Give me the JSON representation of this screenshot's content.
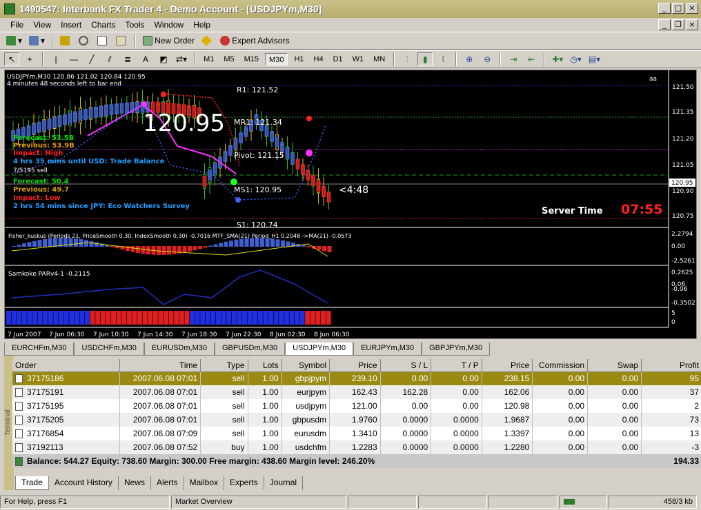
{
  "window": {
    "title": "1490547: Interbank FX Trader 4 - Demo Account - [USDJPYm,M30]"
  },
  "menu": [
    "File",
    "View",
    "Insert",
    "Charts",
    "Tools",
    "Window",
    "Help"
  ],
  "toolbar": {
    "new_order": "New Order",
    "expert_advisors": "Expert Advisors"
  },
  "timeframes": [
    "M1",
    "M5",
    "M15",
    "M30",
    "H1",
    "H4",
    "D1",
    "W1",
    "MN"
  ],
  "active_timeframe": "M30",
  "chart": {
    "header": "USDJPYm,M30  120.86 121.02 120.84 120.95",
    "bar_timer": "4 minutes 48 seconds left to bar end",
    "big_price": "120.95",
    "countdown": "<4:48",
    "server_time_label": "Server Time",
    "server_time": "07:55",
    "aa_label": "aa",
    "levels": {
      "r1": "R1: 121.52",
      "mr1": "MR1: 121.34",
      "pivot": "Pivot: 121.15",
      "ms1": "MS1: 120.95",
      "s1": "S1: 120.74"
    },
    "news": {
      "f1": "Forecast: 53.5B",
      "p1": "Previous: 53.9B",
      "i1": "Impact: High",
      "t1": "4 hrs 35 mins until USD: Trade Balance",
      "sell": "7/5195 sell",
      "f2": "Forecast: 50.4",
      "p2": "Previous: 49.7",
      "i2": "Impact: Low",
      "t2": "2 hrs 54 mins since JPY: Eco Watchers Survey"
    },
    "price_axis": [
      "121.50",
      "121.35",
      "121.20",
      "121.05",
      "120.95",
      "120.90",
      "120.75"
    ],
    "current_price_tag": "120.95",
    "ind1_label": "Fisher_kuskus  (Periods 21, PriceSmooth 0.30, IndexSmooth 0.30)   -0.7016  MTF_SMA(21) Period_H1  0.2048   ->MA(21) -0.0573",
    "ind1_axis": [
      "2.2794",
      "0.00",
      "-2.5261"
    ],
    "ind2_label": "Samkoke PARv4-1  -0.2115",
    "ind2_axis": [
      "0.2625",
      "0.06",
      "-0.06",
      "-0.3502"
    ],
    "ind3_axis": [
      "5",
      "0"
    ],
    "time_axis": [
      "7 Jun 2007",
      "7 Jun 06:30",
      "7 Jun 10:30",
      "7 Jun 14:30",
      "7 Jun 18:30",
      "7 Jun 22:30",
      "8 Jun 02:30",
      "8 Jun 06:30"
    ]
  },
  "chart_tabs": [
    "EURCHFm,M30",
    "USDCHFm,M30",
    "EURUSDm,M30",
    "GBPUSDm,M30",
    "USDJPYm,M30",
    "EURJPYm,M30",
    "GBPJPYm,M30"
  ],
  "active_chart_tab": "USDJPYm,M30",
  "terminal": {
    "side_label": "Terminal",
    "columns": [
      "Order",
      "Time",
      "Type",
      "Lots",
      "Symbol",
      "Price",
      "S / L",
      "T / P",
      "Price",
      "Commission",
      "Swap",
      "Profit"
    ],
    "rows": [
      [
        "37175186",
        "2007.06.08 07:01",
        "sell",
        "1.00",
        "gbpjpym",
        "239.10",
        "0.00",
        "0.00",
        "238.15",
        "0.00",
        "0.00",
        "95"
      ],
      [
        "37175191",
        "2007.06.08 07:01",
        "sell",
        "1.00",
        "eurjpym",
        "162.43",
        "162.28",
        "0.00",
        "162.06",
        "0.00",
        "0.00",
        "37"
      ],
      [
        "37175195",
        "2007.06.08 07:01",
        "sell",
        "1.00",
        "usdjpym",
        "121.00",
        "0.00",
        "0.00",
        "120.98",
        "0.00",
        "0.00",
        "2"
      ],
      [
        "37175205",
        "2007.06.08 07:01",
        "sell",
        "1.00",
        "gbpusdm",
        "1.9760",
        "0.0000",
        "0.0000",
        "1.9687",
        "0.00",
        "0.00",
        "73"
      ],
      [
        "37176854",
        "2007.06.08 07:09",
        "sell",
        "1.00",
        "eurusdm",
        "1.3410",
        "0.0000",
        "0.0000",
        "1.3397",
        "0.00",
        "0.00",
        "13"
      ],
      [
        "37192113",
        "2007.06.08 07:52",
        "buy",
        "1.00",
        "usdchfm",
        "1.2283",
        "0.0000",
        "0.0000",
        "1.2280",
        "0.00",
        "0.00",
        "-3"
      ]
    ],
    "balance_line": "Balance: 544.27  Equity: 738.60  Margin: 300.00  Free margin: 438.60  Margin level: 246.20%",
    "total_profit": "194.33",
    "tabs": [
      "Trade",
      "Account History",
      "News",
      "Alerts",
      "Mailbox",
      "Experts",
      "Journal"
    ],
    "active_tab": "Trade"
  },
  "status": {
    "help": "For Help, press F1",
    "profile": "Market Overview",
    "traffic": "458/3 kb"
  },
  "colors": {
    "title_bg": "#b7ae6e",
    "selected_row": "#9a8a12",
    "server_time": "#ff2020"
  }
}
